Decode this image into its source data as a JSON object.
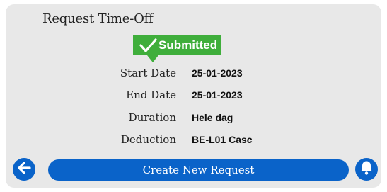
{
  "header": {
    "title": "Request Time-Off"
  },
  "status": {
    "label": "Submitted",
    "icon": "checkmark-icon",
    "color": "#3fae3b"
  },
  "details": [
    {
      "label": "Start Date",
      "value": "25-01-2023"
    },
    {
      "label": "End Date",
      "value": "25-01-2023"
    },
    {
      "label": "Duration",
      "value": "Hele dag"
    },
    {
      "label": "Deduction",
      "value": "BE-L01 Casc"
    }
  ],
  "footer": {
    "back_icon": "arrow-left-icon",
    "create_label": "Create New Request",
    "bell_icon": "bell-icon",
    "accent_color": "#0a63c9"
  }
}
